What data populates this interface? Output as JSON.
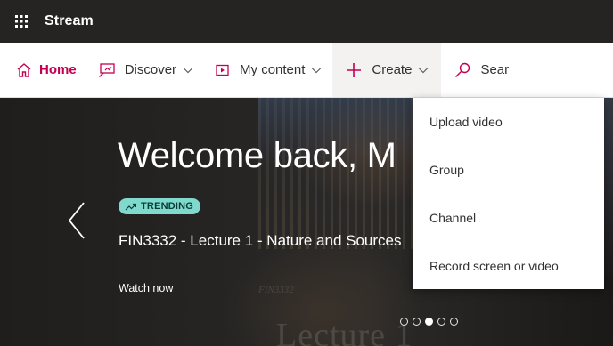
{
  "app": {
    "title": "Stream"
  },
  "topbar": {
    "app_launcher_icon": "waffle-icon"
  },
  "nav": {
    "home": {
      "label": "Home",
      "icon": "home-icon"
    },
    "discover": {
      "label": "Discover",
      "icon": "discover-icon"
    },
    "my_content": {
      "label": "My content",
      "icon": "video-icon"
    },
    "create": {
      "label": "Create",
      "icon": "plus-icon"
    },
    "search": {
      "label": "Sear",
      "icon": "search-icon"
    }
  },
  "hero": {
    "welcome": "Welcome back, M",
    "badge": "TRENDING",
    "video_title": "FIN3332 - Lecture 1 - Nature and Sources",
    "watch_label": "Watch now",
    "watermark_small": "FIN3332",
    "watermark_big": "Lecture 1",
    "carousel": {
      "count": 5,
      "active_index": 2
    }
  },
  "create_menu": {
    "items": [
      "Upload video",
      "Group",
      "Channel",
      "Record screen or video"
    ]
  },
  "colors": {
    "accent": "#c30052",
    "topbar": "#252423",
    "badge": "#7fd9cc"
  }
}
